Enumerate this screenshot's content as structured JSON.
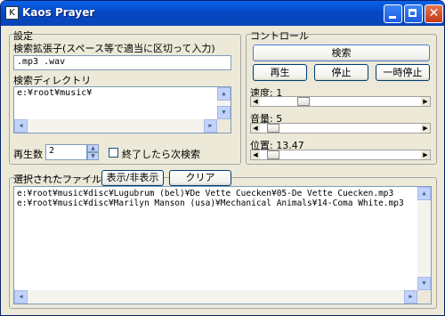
{
  "window": {
    "title": "Kaos Prayer",
    "icon_char": "K"
  },
  "settings": {
    "group_title": "設定",
    "ext_label": "検索拡張子(スペース等で適当に区切って入力)",
    "ext_value": ".mp3 .wav",
    "dir_label": "検索ディレクトリ",
    "dir_value": "e:¥root¥music¥",
    "play_count_label": "再生数",
    "play_count_value": "2",
    "next_search_label": "終了したら次検索"
  },
  "control": {
    "group_title": "コントロール",
    "search_label": "検索",
    "play_label": "再生",
    "stop_label": "停止",
    "pause_label": "一時停止",
    "speed_label": "速度: 1",
    "speed_level": 0.25,
    "volume_label": "音量: 5",
    "volume_level": 0.05,
    "position_label": "位置: 13.47",
    "position_level": 0.05
  },
  "selected_files": {
    "group_title": "選択されたファイル",
    "toggle_label": "表示/非表示",
    "clear_label": "クリア",
    "items": [
      "e:¥root¥music¥disc¥Lugubrum (bel)¥De Vette Cuecken¥05-De Vette Cuecken.mp3",
      "e:¥root¥music¥disc¥Marilyn Manson (usa)¥Mechanical Animals¥14-Coma White.mp3"
    ]
  }
}
